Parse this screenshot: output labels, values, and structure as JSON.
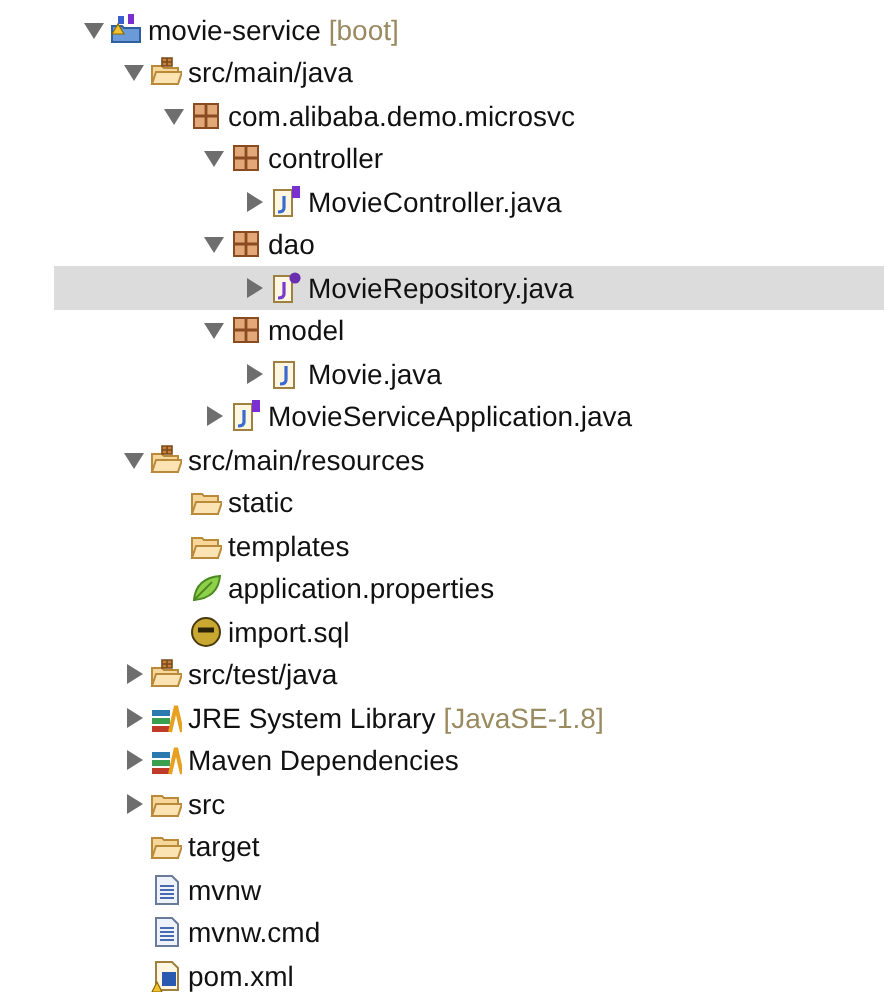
{
  "tree": [
    {
      "label": "movie-service",
      "suffix": "[boot]",
      "kind": "project",
      "expanded": true,
      "selected": false,
      "children": [
        {
          "label": "src/main/java",
          "kind": "source-folder",
          "expanded": true,
          "selected": false,
          "children": [
            {
              "label": "com.alibaba.demo.microsvc",
              "kind": "package",
              "expanded": true,
              "selected": false,
              "children": [
                {
                  "label": "controller",
                  "kind": "package",
                  "expanded": true,
                  "selected": false,
                  "children": [
                    {
                      "label": "MovieController.java",
                      "kind": "java-spring",
                      "expanded": false,
                      "selected": false
                    }
                  ]
                },
                {
                  "label": "dao",
                  "kind": "package",
                  "expanded": true,
                  "selected": false,
                  "children": [
                    {
                      "label": "MovieRepository.java",
                      "kind": "java-interface",
                      "expanded": false,
                      "selected": true
                    }
                  ]
                },
                {
                  "label": "model",
                  "kind": "package",
                  "expanded": true,
                  "selected": false,
                  "children": [
                    {
                      "label": "Movie.java",
                      "kind": "java-class",
                      "expanded": false,
                      "selected": false
                    }
                  ]
                },
                {
                  "label": "MovieServiceApplication.java",
                  "kind": "java-spring",
                  "expanded": false,
                  "selected": false
                }
              ]
            }
          ]
        },
        {
          "label": "src/main/resources",
          "kind": "source-folder",
          "expanded": true,
          "selected": false,
          "children": [
            {
              "label": "static",
              "kind": "folder",
              "selected": false
            },
            {
              "label": "templates",
              "kind": "folder",
              "selected": false
            },
            {
              "label": "application.properties",
              "kind": "properties",
              "selected": false
            },
            {
              "label": "import.sql",
              "kind": "sql",
              "selected": false
            }
          ]
        },
        {
          "label": "src/test/java",
          "kind": "source-folder",
          "expanded": false,
          "selected": false
        },
        {
          "label": "JRE System Library",
          "suffix": "[JavaSE-1.8]",
          "kind": "library",
          "expanded": false,
          "selected": false
        },
        {
          "label": "Maven Dependencies",
          "kind": "library",
          "expanded": false,
          "selected": false
        },
        {
          "label": "src",
          "kind": "folder",
          "expanded": false,
          "selected": false
        },
        {
          "label": "target",
          "kind": "folder",
          "selected": false
        },
        {
          "label": "mvnw",
          "kind": "file",
          "selected": false
        },
        {
          "label": "mvnw.cmd",
          "kind": "file",
          "selected": false
        },
        {
          "label": "pom.xml",
          "kind": "pom",
          "selected": false
        }
      ]
    }
  ]
}
